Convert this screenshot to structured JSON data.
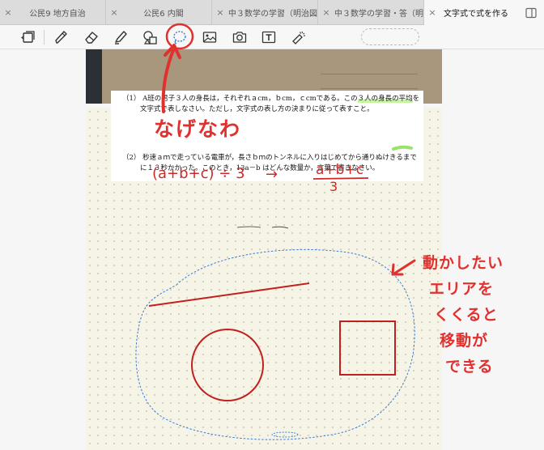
{
  "tabs": [
    {
      "close": "×",
      "title": "公民9 地方自治"
    },
    {
      "close": "×",
      "title": "公民6 内閣"
    },
    {
      "close": "×",
      "title": "中３数学の学習（明治図…"
    },
    {
      "close": "×",
      "title": "中３数学の学習・答（明…"
    },
    {
      "close": "×",
      "title": "文字式で式を作る"
    }
  ],
  "icons": {
    "sidebar": "sidebar-toggle-icon",
    "pages": "page-view-icon",
    "pen": "pen-icon",
    "eraser": "eraser-icon",
    "highlighter": "highlighter-icon",
    "shapes": "shapes-icon",
    "lasso": "lasso-icon",
    "image": "image-icon",
    "camera": "camera-icon",
    "text": "text-box-icon",
    "laser": "laser-pointer-icon"
  },
  "colors": {
    "annotation": "#e0312f",
    "lasso_selection": "#3a7bd5",
    "highlight": "#c8f3a3"
  },
  "question1": {
    "line1_a": "（1） A班の男子３人の身長は，それぞれａcm，ｂcm，ｃcmである。この",
    "line1_b": "３人の身長の平均",
    "line1_c": "を",
    "line2": "文字式で表しなさい。ただし，文字式の表し方の決まりに従って表すこと。"
  },
  "question2": {
    "line1": "（2） 秒速ａｍで走っている電車が，長さｂｍのトンネルに入りはじめてから通りぬけきるまで",
    "line2": "に１３秒かかった。このとき，13a－b はどんな数量か，言葉で書きなさい。"
  },
  "handwriting": {
    "lasso_label": "なげなわ",
    "expr": "(a+b+c) ÷ 3",
    "arrow": "→",
    "frac_num": "a+b+c",
    "frac_den": "3",
    "note_lines": [
      "動かしたい",
      "エリアを",
      "くくると",
      "移動が",
      "できる"
    ]
  }
}
